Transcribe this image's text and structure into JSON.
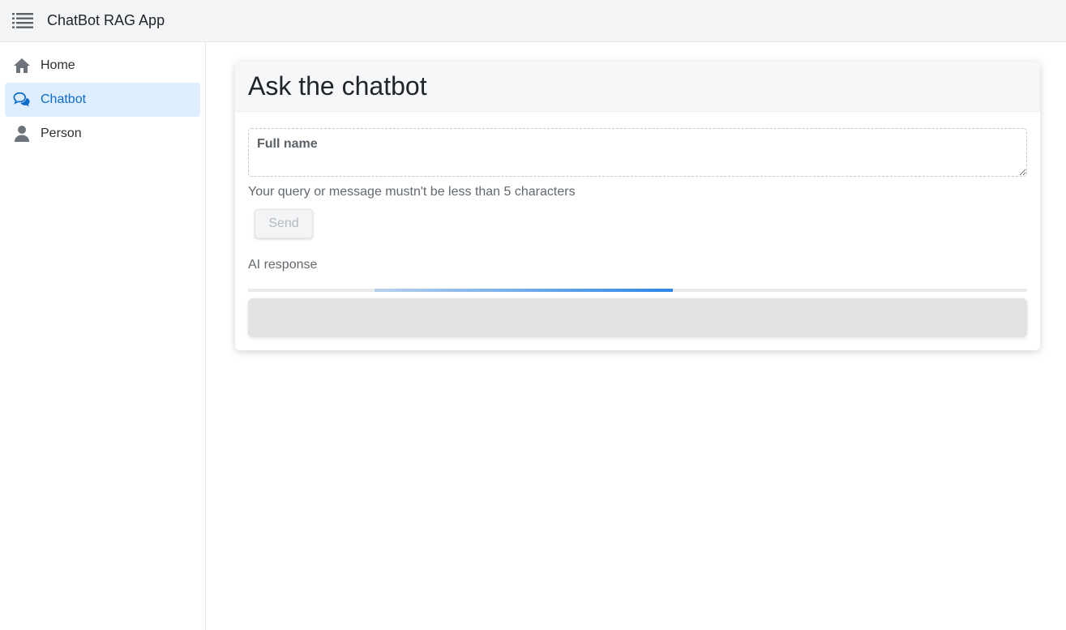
{
  "app": {
    "title": "ChatBot RAG App"
  },
  "sidebar": {
    "items": [
      {
        "label": "Home",
        "icon": "home-icon",
        "active": false
      },
      {
        "label": "Chatbot",
        "icon": "chat-icon",
        "active": true
      },
      {
        "label": "Person",
        "icon": "person-icon",
        "active": false
      }
    ]
  },
  "card": {
    "title": "Ask the chatbot",
    "field": {
      "label": "Full name",
      "value": ""
    },
    "helper": "Your query or message mustn't be less than 5 characters",
    "send_label": "Send",
    "ai_label": "AI response",
    "response_text": ""
  },
  "colors": {
    "accent": "#0d6bc9",
    "active_bg": "#dfeefe",
    "progress": "#2c86e8"
  }
}
